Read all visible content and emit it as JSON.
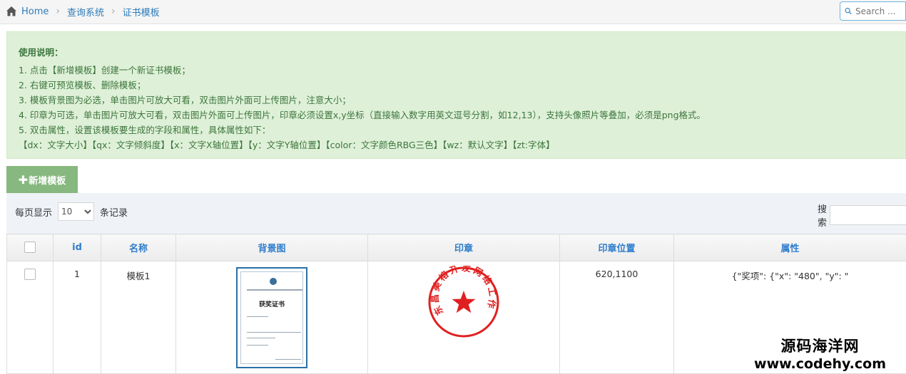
{
  "breadcrumb": {
    "home": "Home",
    "level1": "查询系统",
    "level2": "证书模板"
  },
  "nav_search": {
    "placeholder": "Search ..."
  },
  "notice": {
    "title": "使用说明：",
    "lines": [
      "1. 点击【新增模板】创建一个新证书模板；",
      "2. 右键可预览模板、删除模板；",
      "3. 模板背景图为必选，单击图片可放大可看，双击图片外面可上传图片，注意大小；",
      "4. 印章为可选，单击图片可放大可看，双击图片外面可上传图片，印章必须设置x,y坐标（直接输入数字用英文逗号分割，如12,13），支持头像照片等叠加，必须是png格式。",
      "5. 双击属性，设置该模板要生成的字段和属性，具体属性如下：",
      "【dx：文字大小】【qx：文字倾斜度】【x：文字X轴位置】【y：文字Y轴位置】【color：文字颜色RBG三色】【wz：默认文字】【zt:字体】"
    ]
  },
  "add_button": {
    "icon": "plus-icon",
    "label": "新增模板"
  },
  "table_controls": {
    "per_page_prefix": "每页显示",
    "per_page_value": "10",
    "per_page_suffix": "条记录",
    "search_label": "搜索"
  },
  "table": {
    "headers": [
      "id",
      "名称",
      "背景图",
      "印章",
      "印章位置",
      "属性"
    ],
    "rows": [
      {
        "id": "1",
        "name": "模板1",
        "seal_position": "620,1100",
        "attributes": "{\"奖项\": {\"x\": \"480\", \"y\": \""
      }
    ],
    "thumbnail": {
      "title": "获奖证书"
    },
    "seal": {
      "text": "东昌美榕开发网络工作室"
    }
  },
  "watermark": {
    "cn": "源码海洋网",
    "en": "www.codehy.com"
  },
  "colors": {
    "link": "#2d7cb8",
    "notice_bg": "#dff0d8",
    "notice_text": "#3c763d",
    "add_button": "#87b87f",
    "header_text": "#307ecc",
    "seal_red": "#e02020"
  }
}
